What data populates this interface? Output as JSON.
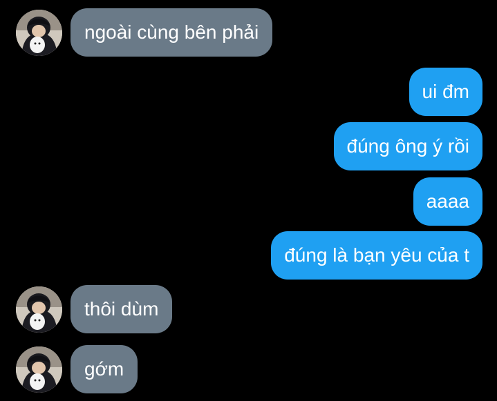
{
  "colors": {
    "background": "#000000",
    "incoming_bubble": "#6a7a88",
    "outgoing_bubble": "#1fa0f2",
    "text": "#ffffff"
  },
  "messages": [
    {
      "side": "incoming",
      "text": "ngoài cùng bên phải",
      "avatar": true
    },
    {
      "side": "outgoing",
      "text": "ui đm"
    },
    {
      "side": "outgoing",
      "text": "đúng ông ý rồi"
    },
    {
      "side": "outgoing",
      "text": "aaaa"
    },
    {
      "side": "outgoing",
      "text": "đúng là bạn yêu của t"
    },
    {
      "side": "incoming",
      "text": "thôi dùm",
      "avatar": true
    },
    {
      "side": "incoming",
      "text": "gớm",
      "avatar": true
    }
  ]
}
